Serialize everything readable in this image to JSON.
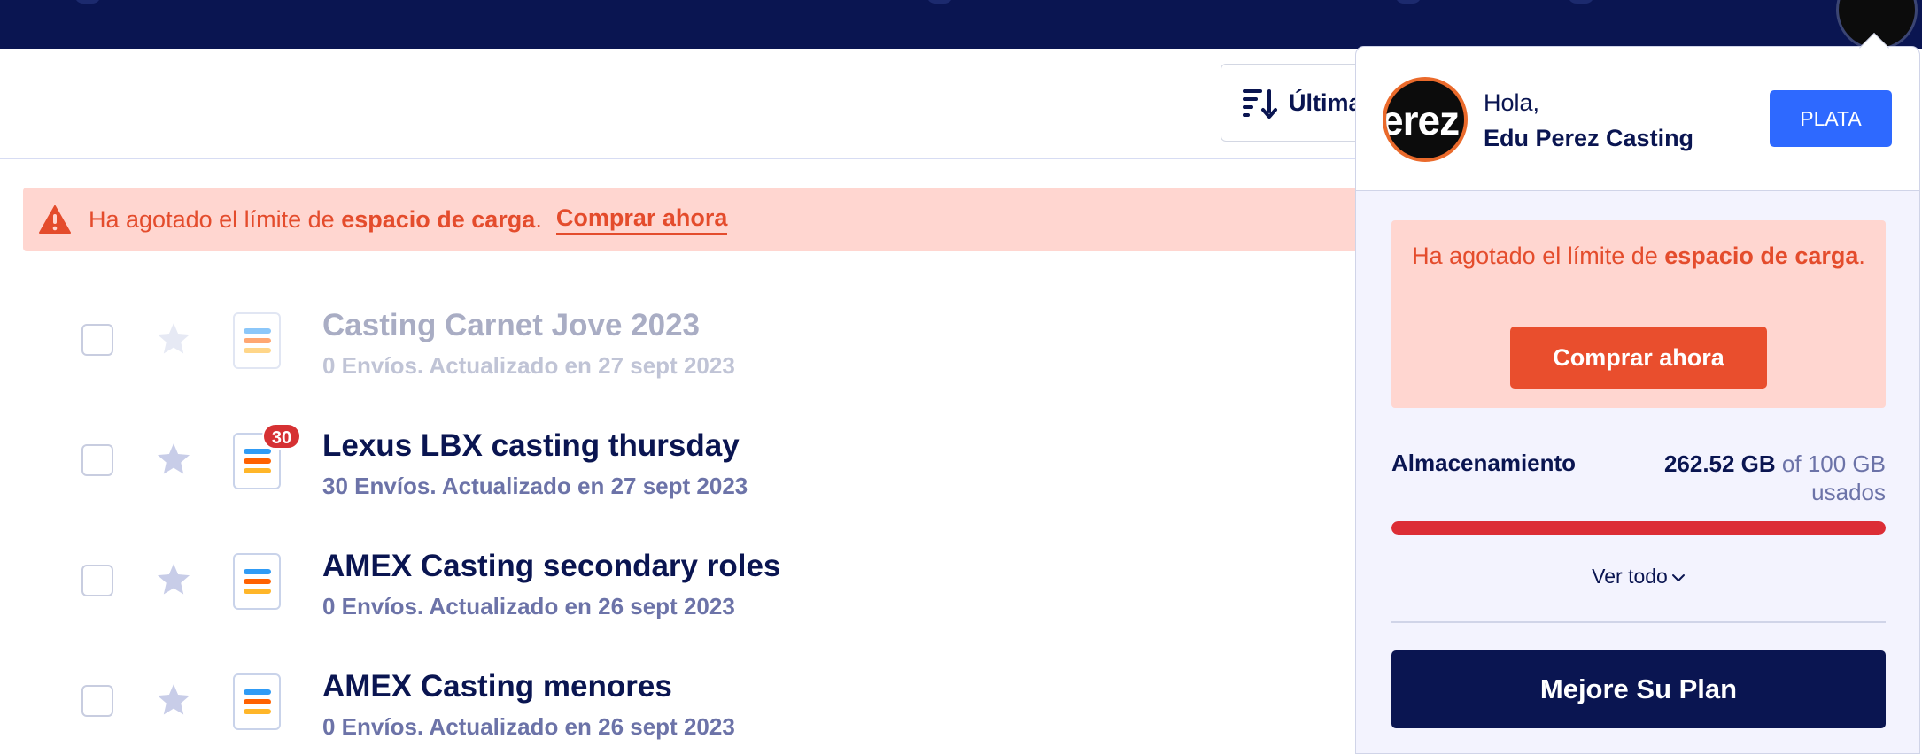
{
  "toolbar": {
    "sort_label": "Última",
    "sort_icon": "sort-descending-icon"
  },
  "alert": {
    "text_before": "Ha agotado el límite de ",
    "text_bold": "espacio de carga",
    "text_after": ".",
    "link": "Comprar ahora",
    "icon": "warning-icon"
  },
  "forms": [
    {
      "title": "Casting Carnet Jove 2023",
      "meta": "0 Envíos. Actualizado en 27 sept 2023",
      "badge": "",
      "faded": true
    },
    {
      "title": "Lexus LBX casting thursday",
      "meta": "30 Envíos. Actualizado en 27 sept 2023",
      "badge": "30",
      "faded": false
    },
    {
      "title": "AMEX Casting secondary roles",
      "meta": "0 Envíos. Actualizado en 26 sept 2023",
      "badge": "",
      "faded": false
    },
    {
      "title": "AMEX Casting menores",
      "meta": "0 Envíos. Actualizado en 26 sept 2023",
      "badge": "",
      "faded": false
    }
  ],
  "account_panel": {
    "avatar_text": "erez",
    "greeting": "Hola,",
    "user_name": "Edu Perez Casting",
    "plan_label": "PLATA",
    "limit_text_before": "Ha agotado el límite de ",
    "limit_text_bold": "espacio de carga",
    "limit_text_after": ".",
    "buy_label": "Comprar ahora",
    "storage_label": "Almacenamiento",
    "storage_used": "262.52 GB",
    "storage_of": "of 100 GB",
    "storage_suffix": "usados",
    "storage_fill_fraction": 1.0,
    "view_all_label": "Ver todo",
    "upgrade_label": "Mejore Su Plan"
  },
  "colors": {
    "navy": "#0a1551",
    "alert_bg": "#ffd6d0",
    "alert_text": "#e44c2c",
    "plan_blue": "#2e69ff",
    "buy_orange": "#e94e2d",
    "storage_red": "#dc2d36",
    "badge_red": "#d63133"
  }
}
